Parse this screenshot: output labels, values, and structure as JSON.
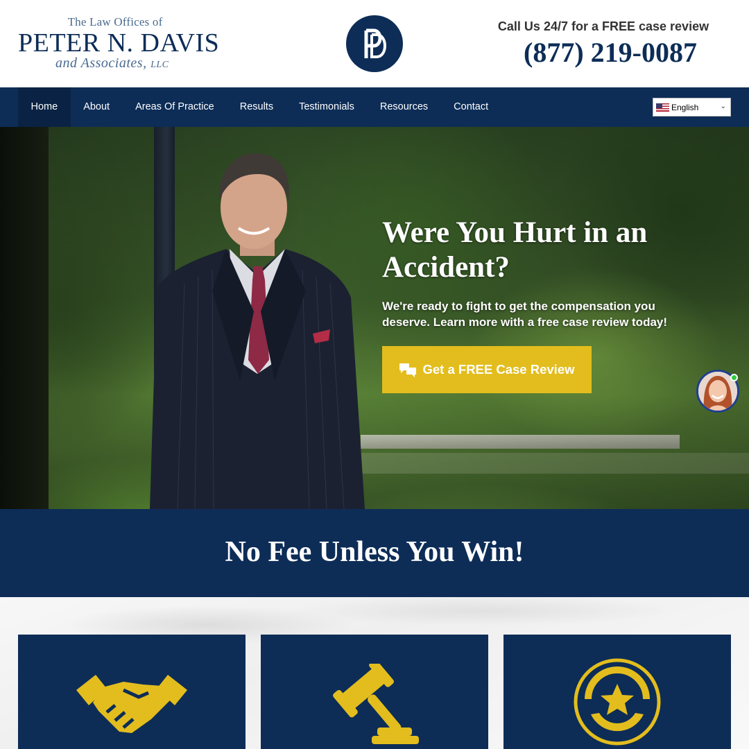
{
  "header": {
    "logo": {
      "line1": "The Law Offices of",
      "line2": "PETER N. DAVIS",
      "line3": "and Associates,",
      "line3_suffix": "LLC"
    },
    "monogram": "PD",
    "call_text": "Call Us 24/7 for a FREE case review",
    "phone": "(877) 219-0087"
  },
  "nav": {
    "items": [
      {
        "label": "Home",
        "active": true
      },
      {
        "label": "About"
      },
      {
        "label": "Areas Of Practice"
      },
      {
        "label": "Results"
      },
      {
        "label": "Testimonials"
      },
      {
        "label": "Resources"
      },
      {
        "label": "Contact"
      }
    ],
    "language": "English"
  },
  "hero": {
    "title": "Were You Hurt in an Accident?",
    "subtitle": "We're ready to fight to get the compensation you deserve. Learn more with a free case review today!",
    "cta_label": "Get a FREE Case Review",
    "cta_icon": "chat-bubbles-icon"
  },
  "banner": {
    "title": "No Fee Unless You Win!"
  },
  "cards": [
    {
      "icon": "handshake-icon"
    },
    {
      "icon": "gavel-icon"
    },
    {
      "icon": "star-medal-icon"
    }
  ],
  "colors": {
    "navy": "#0d2d57",
    "gold": "#e3bd1d",
    "nav_active": "#0a2344"
  }
}
